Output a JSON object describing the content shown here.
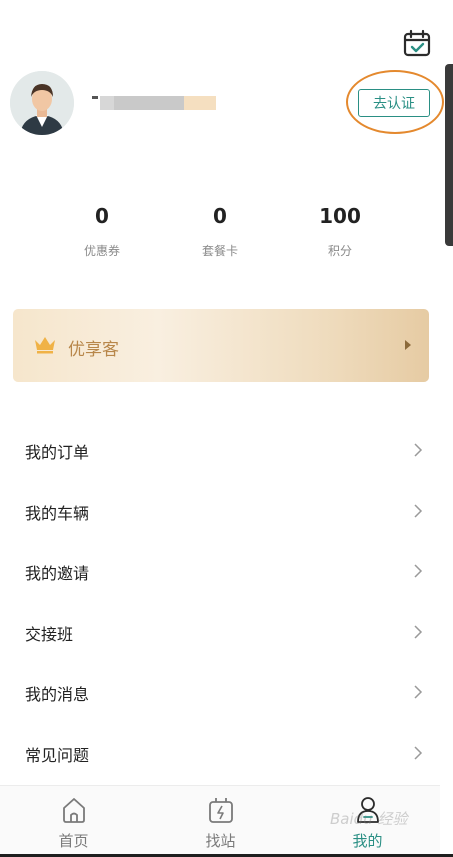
{
  "header": {
    "calendar_icon": "calendar-check-icon",
    "verify_button_label": "去认证"
  },
  "stats": [
    {
      "value": "0",
      "label": "优惠券"
    },
    {
      "value": "0",
      "label": "套餐卡"
    },
    {
      "value": "100",
      "label": "积分"
    }
  ],
  "vip": {
    "label": "优享客",
    "crown_color": "#f0b246"
  },
  "menu": [
    {
      "label": "我的订单"
    },
    {
      "label": "我的车辆"
    },
    {
      "label": "我的邀请"
    },
    {
      "label": "交接班"
    },
    {
      "label": "我的消息"
    },
    {
      "label": "常见问题"
    }
  ],
  "tabbar": [
    {
      "label": "首页",
      "icon": "home-icon",
      "active": false
    },
    {
      "label": "找站",
      "icon": "charging-station-icon",
      "active": false
    },
    {
      "label": "我的",
      "icon": "user-icon",
      "active": true
    }
  ],
  "colors": {
    "accent": "#2a8f84",
    "annotation": "#e4892e",
    "vip_text": "#b8874a"
  },
  "watermark": "Baidu 经验"
}
